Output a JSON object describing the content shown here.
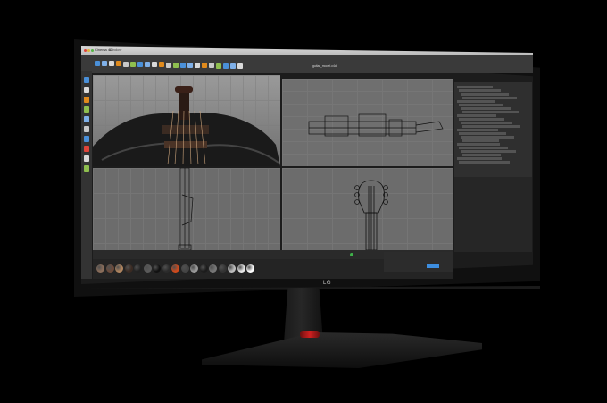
{
  "brand": {
    "logo": "LG"
  },
  "app": {
    "title": "Cinema 4D",
    "menu": "Window",
    "document_title": "guitar_model.c4d"
  },
  "colors": {
    "screen_bg": "#1c1c1c",
    "viewport": "#6f6f6f",
    "accent_orange": "#e08a1c",
    "accent_blue": "#3d8ee0",
    "stand_accent": "#d02020"
  },
  "toolbar": {
    "icons": [
      "undo-icon",
      "redo-icon",
      "select-icon",
      "move-icon",
      "scale-icon",
      "rotate-icon",
      "x-axis-icon",
      "y-axis-icon",
      "z-axis-icon",
      "world-icon",
      "render-view-icon",
      "render-icon",
      "render-settings-icon",
      "cube-icon",
      "pen-icon",
      "subdivision-icon",
      "array-icon",
      "deformer-icon",
      "floor-icon",
      "camera-icon",
      "light-icon"
    ]
  },
  "viewports": [
    "Perspective",
    "Top",
    "Right",
    "Front"
  ],
  "materials": [
    "mat-1",
    "mat-2",
    "mat-3",
    "mat-4",
    "mat-5",
    "mat-6",
    "mat-7",
    "mat-8",
    "mat-9",
    "mat-10",
    "mat-11",
    "mat-12",
    "mat-13",
    "mat-14",
    "mat-15",
    "mat-16",
    "mat-17"
  ]
}
